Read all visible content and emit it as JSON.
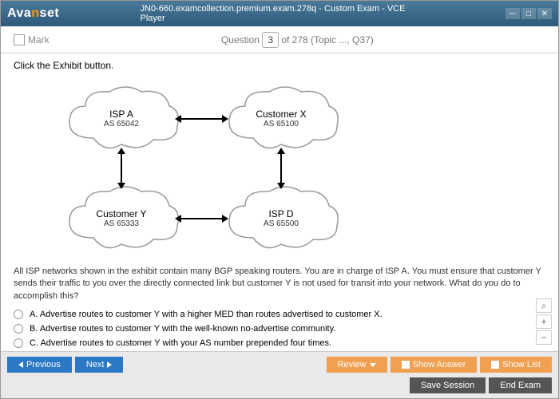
{
  "header": {
    "logo_prefix": "Ava",
    "logo_accent": "n",
    "logo_suffix": "set",
    "title": "JN0-660.examcollection.premium.exam.278q - Custom Exam - VCE Player"
  },
  "mark": {
    "label": "Mark"
  },
  "counter": {
    "label": "Question",
    "current": "3",
    "total": "of 278 (Topic ..., Q37)"
  },
  "exhibit": {
    "prompt": "Click the Exhibit button."
  },
  "clouds": {
    "c1": {
      "name": "ISP A",
      "as": "AS 65042"
    },
    "c2": {
      "name": "Customer X",
      "as": "AS 65100"
    },
    "c3": {
      "name": "Customer Y",
      "as": "AS 65333"
    },
    "c4": {
      "name": "ISP D",
      "as": "AS 65500"
    }
  },
  "question": "All ISP networks shown in the exhibit contain many BGP speaking routers. You are in charge of ISP A. You must ensure that customer Y sends their traffic to you over the directly connected link but customer Y is not used for transit into your network. What do you do to accomplish this?",
  "opts": {
    "a": "A.   Advertise routes to customer Y with a higher MED than routes advertised to customer X.",
    "b": "B.   Advertise routes to customer Y with the well-known no-advertise community.",
    "c": "C.   Advertise routes to customer Y with your AS number prepended four times."
  },
  "buttons": {
    "prev": "Previous",
    "next": "Next",
    "review": "Review",
    "show_answer": "Show Answer",
    "show_list": "Show List",
    "save_session": "Save Session",
    "end_exam": "End Exam"
  }
}
